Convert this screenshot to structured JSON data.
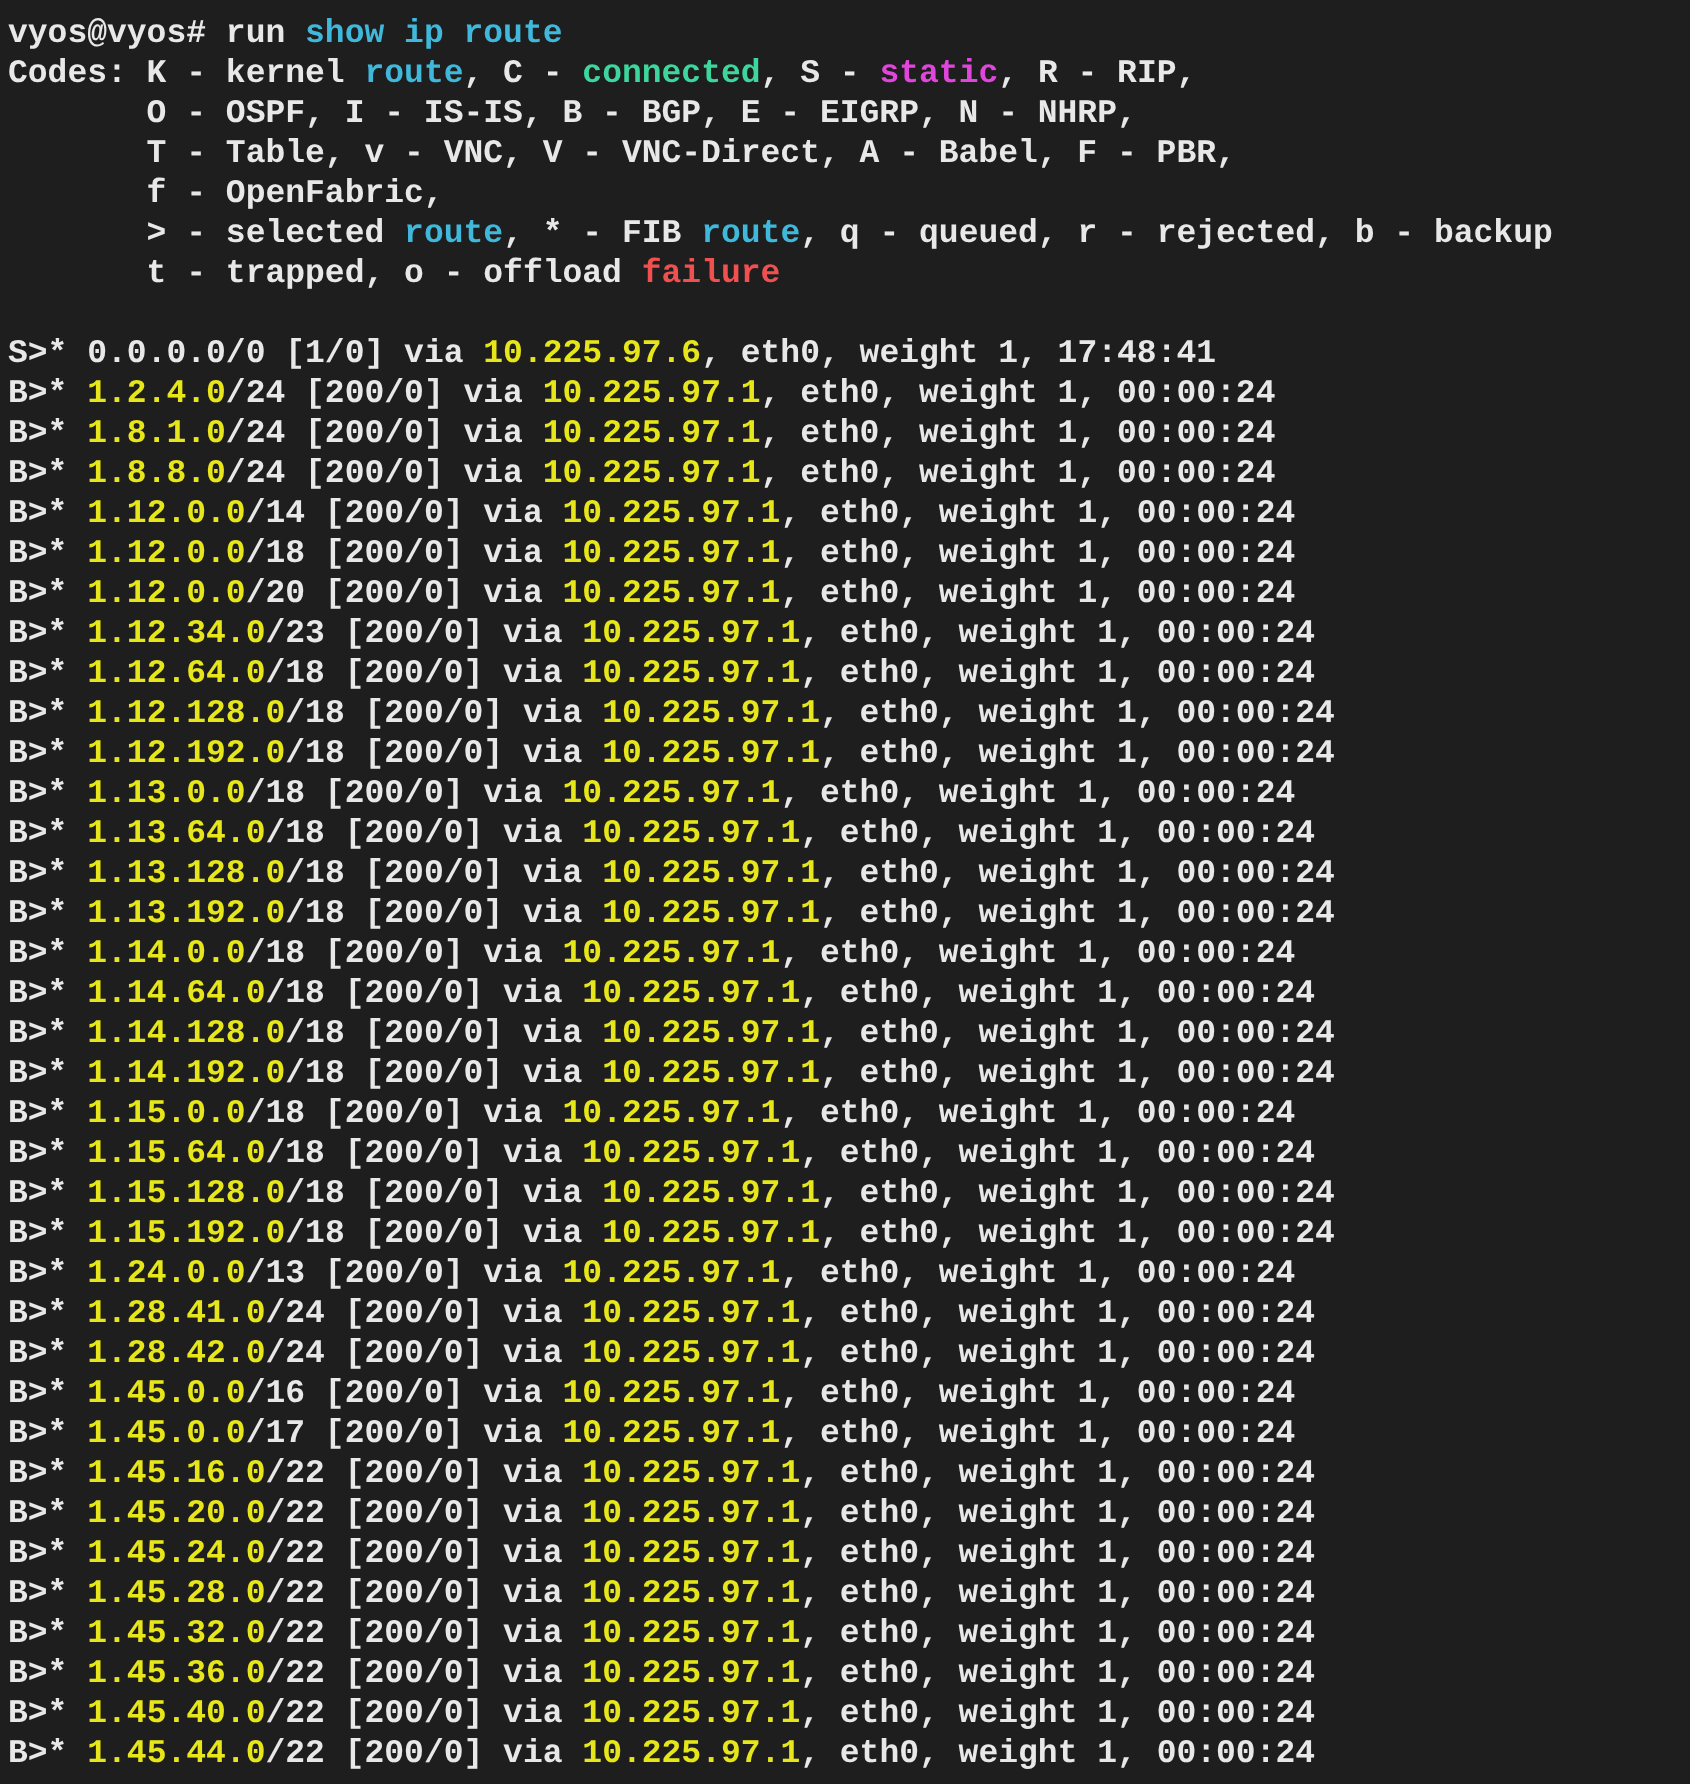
{
  "prompt": {
    "user_host": "vyos@vyos#",
    "command_plain": "run",
    "command_highlight": "show ip route"
  },
  "codes": [
    [
      {
        "text": "Codes: K - kernel ",
        "kind": "plain"
      },
      {
        "text": "route",
        "kind": "keyword"
      },
      {
        "text": ", C - ",
        "kind": "plain"
      },
      {
        "text": "connected",
        "kind": "connected"
      },
      {
        "text": ", S - ",
        "kind": "plain"
      },
      {
        "text": "static",
        "kind": "static"
      },
      {
        "text": ", R - RIP,",
        "kind": "plain"
      }
    ],
    [
      {
        "text": "       O - OSPF, I - IS-IS, B - BGP, E - EIGRP, N - NHRP,",
        "kind": "plain"
      }
    ],
    [
      {
        "text": "       T - Table, v - VNC, V - VNC-Direct, A - Babel, F - PBR,",
        "kind": "plain"
      }
    ],
    [
      {
        "text": "       f - OpenFabric,",
        "kind": "plain"
      }
    ],
    [
      {
        "text": "       > - selected ",
        "kind": "plain"
      },
      {
        "text": "route",
        "kind": "keyword"
      },
      {
        "text": ", * - FIB ",
        "kind": "plain"
      },
      {
        "text": "route",
        "kind": "keyword"
      },
      {
        "text": ", q - queued, r - rejected, b - backup",
        "kind": "plain"
      }
    ],
    [
      {
        "text": "       t - trapped, o - offload ",
        "kind": "plain"
      },
      {
        "text": "failure",
        "kind": "failure"
      }
    ]
  ],
  "routes": [
    {
      "code": "S>*",
      "network": "0.0.0.0",
      "network_highlighted": false,
      "after_network": "/0 [1/0] via",
      "gateway": "10.225.97.6",
      "after_gateway": ", eth0, weight 1, 17:48:41"
    },
    {
      "code": "B>*",
      "network": "1.2.4.0",
      "network_highlighted": true,
      "after_network": "/24 [200/0] via",
      "gateway": "10.225.97.1",
      "after_gateway": ", eth0, weight 1, 00:00:24"
    },
    {
      "code": "B>*",
      "network": "1.8.1.0",
      "network_highlighted": true,
      "after_network": "/24 [200/0] via",
      "gateway": "10.225.97.1",
      "after_gateway": ", eth0, weight 1, 00:00:24"
    },
    {
      "code": "B>*",
      "network": "1.8.8.0",
      "network_highlighted": true,
      "after_network": "/24 [200/0] via",
      "gateway": "10.225.97.1",
      "after_gateway": ", eth0, weight 1, 00:00:24"
    },
    {
      "code": "B>*",
      "network": "1.12.0.0",
      "network_highlighted": true,
      "after_network": "/14 [200/0] via",
      "gateway": "10.225.97.1",
      "after_gateway": ", eth0, weight 1, 00:00:24"
    },
    {
      "code": "B>*",
      "network": "1.12.0.0",
      "network_highlighted": true,
      "after_network": "/18 [200/0] via",
      "gateway": "10.225.97.1",
      "after_gateway": ", eth0, weight 1, 00:00:24"
    },
    {
      "code": "B>*",
      "network": "1.12.0.0",
      "network_highlighted": true,
      "after_network": "/20 [200/0] via",
      "gateway": "10.225.97.1",
      "after_gateway": ", eth0, weight 1, 00:00:24"
    },
    {
      "code": "B>*",
      "network": "1.12.34.0",
      "network_highlighted": true,
      "after_network": "/23 [200/0] via",
      "gateway": "10.225.97.1",
      "after_gateway": ", eth0, weight 1, 00:00:24"
    },
    {
      "code": "B>*",
      "network": "1.12.64.0",
      "network_highlighted": true,
      "after_network": "/18 [200/0] via",
      "gateway": "10.225.97.1",
      "after_gateway": ", eth0, weight 1, 00:00:24"
    },
    {
      "code": "B>*",
      "network": "1.12.128.0",
      "network_highlighted": true,
      "after_network": "/18 [200/0] via",
      "gateway": "10.225.97.1",
      "after_gateway": ", eth0, weight 1, 00:00:24"
    },
    {
      "code": "B>*",
      "network": "1.12.192.0",
      "network_highlighted": true,
      "after_network": "/18 [200/0] via",
      "gateway": "10.225.97.1",
      "after_gateway": ", eth0, weight 1, 00:00:24"
    },
    {
      "code": "B>*",
      "network": "1.13.0.0",
      "network_highlighted": true,
      "after_network": "/18 [200/0] via",
      "gateway": "10.225.97.1",
      "after_gateway": ", eth0, weight 1, 00:00:24"
    },
    {
      "code": "B>*",
      "network": "1.13.64.0",
      "network_highlighted": true,
      "after_network": "/18 [200/0] via",
      "gateway": "10.225.97.1",
      "after_gateway": ", eth0, weight 1, 00:00:24"
    },
    {
      "code": "B>*",
      "network": "1.13.128.0",
      "network_highlighted": true,
      "after_network": "/18 [200/0] via",
      "gateway": "10.225.97.1",
      "after_gateway": ", eth0, weight 1, 00:00:24"
    },
    {
      "code": "B>*",
      "network": "1.13.192.0",
      "network_highlighted": true,
      "after_network": "/18 [200/0] via",
      "gateway": "10.225.97.1",
      "after_gateway": ", eth0, weight 1, 00:00:24"
    },
    {
      "code": "B>*",
      "network": "1.14.0.0",
      "network_highlighted": true,
      "after_network": "/18 [200/0] via",
      "gateway": "10.225.97.1",
      "after_gateway": ", eth0, weight 1, 00:00:24"
    },
    {
      "code": "B>*",
      "network": "1.14.64.0",
      "network_highlighted": true,
      "after_network": "/18 [200/0] via",
      "gateway": "10.225.97.1",
      "after_gateway": ", eth0, weight 1, 00:00:24"
    },
    {
      "code": "B>*",
      "network": "1.14.128.0",
      "network_highlighted": true,
      "after_network": "/18 [200/0] via",
      "gateway": "10.225.97.1",
      "after_gateway": ", eth0, weight 1, 00:00:24"
    },
    {
      "code": "B>*",
      "network": "1.14.192.0",
      "network_highlighted": true,
      "after_network": "/18 [200/0] via",
      "gateway": "10.225.97.1",
      "after_gateway": ", eth0, weight 1, 00:00:24"
    },
    {
      "code": "B>*",
      "network": "1.15.0.0",
      "network_highlighted": true,
      "after_network": "/18 [200/0] via",
      "gateway": "10.225.97.1",
      "after_gateway": ", eth0, weight 1, 00:00:24"
    },
    {
      "code": "B>*",
      "network": "1.15.64.0",
      "network_highlighted": true,
      "after_network": "/18 [200/0] via",
      "gateway": "10.225.97.1",
      "after_gateway": ", eth0, weight 1, 00:00:24"
    },
    {
      "code": "B>*",
      "network": "1.15.128.0",
      "network_highlighted": true,
      "after_network": "/18 [200/0] via",
      "gateway": "10.225.97.1",
      "after_gateway": ", eth0, weight 1, 00:00:24"
    },
    {
      "code": "B>*",
      "network": "1.15.192.0",
      "network_highlighted": true,
      "after_network": "/18 [200/0] via",
      "gateway": "10.225.97.1",
      "after_gateway": ", eth0, weight 1, 00:00:24"
    },
    {
      "code": "B>*",
      "network": "1.24.0.0",
      "network_highlighted": true,
      "after_network": "/13 [200/0] via",
      "gateway": "10.225.97.1",
      "after_gateway": ", eth0, weight 1, 00:00:24"
    },
    {
      "code": "B>*",
      "network": "1.28.41.0",
      "network_highlighted": true,
      "after_network": "/24 [200/0] via",
      "gateway": "10.225.97.1",
      "after_gateway": ", eth0, weight 1, 00:00:24"
    },
    {
      "code": "B>*",
      "network": "1.28.42.0",
      "network_highlighted": true,
      "after_network": "/24 [200/0] via",
      "gateway": "10.225.97.1",
      "after_gateway": ", eth0, weight 1, 00:00:24"
    },
    {
      "code": "B>*",
      "network": "1.45.0.0",
      "network_highlighted": true,
      "after_network": "/16 [200/0] via",
      "gateway": "10.225.97.1",
      "after_gateway": ", eth0, weight 1, 00:00:24"
    },
    {
      "code": "B>*",
      "network": "1.45.0.0",
      "network_highlighted": true,
      "after_network": "/17 [200/0] via",
      "gateway": "10.225.97.1",
      "after_gateway": ", eth0, weight 1, 00:00:24"
    },
    {
      "code": "B>*",
      "network": "1.45.16.0",
      "network_highlighted": true,
      "after_network": "/22 [200/0] via",
      "gateway": "10.225.97.1",
      "after_gateway": ", eth0, weight 1, 00:00:24"
    },
    {
      "code": "B>*",
      "network": "1.45.20.0",
      "network_highlighted": true,
      "after_network": "/22 [200/0] via",
      "gateway": "10.225.97.1",
      "after_gateway": ", eth0, weight 1, 00:00:24"
    },
    {
      "code": "B>*",
      "network": "1.45.24.0",
      "network_highlighted": true,
      "after_network": "/22 [200/0] via",
      "gateway": "10.225.97.1",
      "after_gateway": ", eth0, weight 1, 00:00:24"
    },
    {
      "code": "B>*",
      "network": "1.45.28.0",
      "network_highlighted": true,
      "after_network": "/22 [200/0] via",
      "gateway": "10.225.97.1",
      "after_gateway": ", eth0, weight 1, 00:00:24"
    },
    {
      "code": "B>*",
      "network": "1.45.32.0",
      "network_highlighted": true,
      "after_network": "/22 [200/0] via",
      "gateway": "10.225.97.1",
      "after_gateway": ", eth0, weight 1, 00:00:24"
    },
    {
      "code": "B>*",
      "network": "1.45.36.0",
      "network_highlighted": true,
      "after_network": "/22 [200/0] via",
      "gateway": "10.225.97.1",
      "after_gateway": ", eth0, weight 1, 00:00:24"
    },
    {
      "code": "B>*",
      "network": "1.45.40.0",
      "network_highlighted": true,
      "after_network": "/22 [200/0] via",
      "gateway": "10.225.97.1",
      "after_gateway": ", eth0, weight 1, 00:00:24"
    },
    {
      "code": "B>*",
      "network": "1.45.44.0",
      "network_highlighted": true,
      "after_network": "/22 [200/0] via",
      "gateway": "10.225.97.1",
      "after_gateway": ", eth0, weight 1, 00:00:24"
    }
  ]
}
